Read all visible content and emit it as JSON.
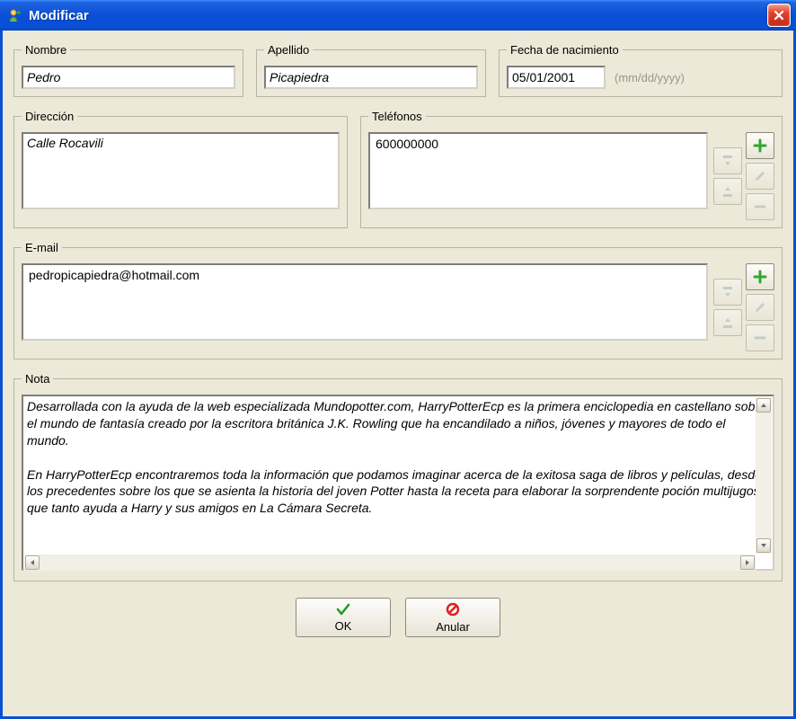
{
  "window": {
    "title": "Modificar"
  },
  "labels": {
    "nombre": "Nombre",
    "apellido": "Apellido",
    "fecha": "Fecha de nacimiento",
    "fecha_hint": "(mm/dd/yyyy)",
    "direccion": "Dirección",
    "telefonos": "Teléfonos",
    "email": "E-mail",
    "nota": "Nota"
  },
  "values": {
    "nombre": "Pedro",
    "apellido": "Picapiedra",
    "fecha": "05/01/2001",
    "direccion": "Calle Rocavili",
    "telefonos": [
      "600000000"
    ],
    "emails": [
      "pedropicapiedra@hotmail.com"
    ],
    "nota": "Desarrollada con la ayuda de la web especializada Mundopotter.com, HarryPotterEcp es la primera enciclopedia en castellano sobre el mundo de fantasía creado por la escritora británica J.K. Rowling que ha encandilado a niños, jóvenes y mayores de todo el mundo.\n\nEn HarryPotterEcp encontraremos toda la información que podamos imaginar acerca de la exitosa saga de libros y películas, desde los precedentes sobre los que se asienta la historia del joven Potter hasta la receta para elaborar la sorprendente poción multijugos que tanto ayuda a Harry y sus amigos en La Cámara Secreta."
  },
  "buttons": {
    "ok": "OK",
    "cancel": "Anular"
  }
}
